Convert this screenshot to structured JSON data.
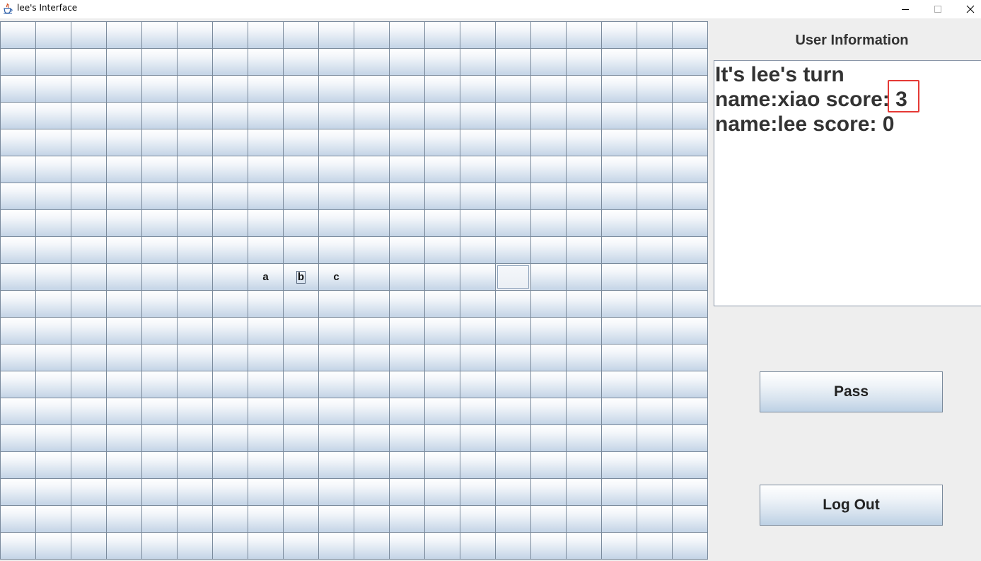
{
  "window": {
    "title": "lee's Interface",
    "icon": "java-cup-icon",
    "controls": [
      "minimize",
      "maximize",
      "close"
    ]
  },
  "board": {
    "columns": 20,
    "rows": 20,
    "tiles": [
      {
        "row": 9,
        "col": 7,
        "letter": "a"
      },
      {
        "row": 9,
        "col": 8,
        "letter": "b",
        "focused_text": true
      },
      {
        "row": 9,
        "col": 9,
        "letter": "c"
      }
    ],
    "selected_cell": {
      "row": 9,
      "col": 14
    }
  },
  "info": {
    "title": "User Information",
    "lines": [
      "It's lee's turn",
      "name:xiao score: 3",
      "name:lee score: 0"
    ],
    "highlight_color": "#e53935"
  },
  "buttons": {
    "pass": "Pass",
    "logout": "Log Out"
  }
}
